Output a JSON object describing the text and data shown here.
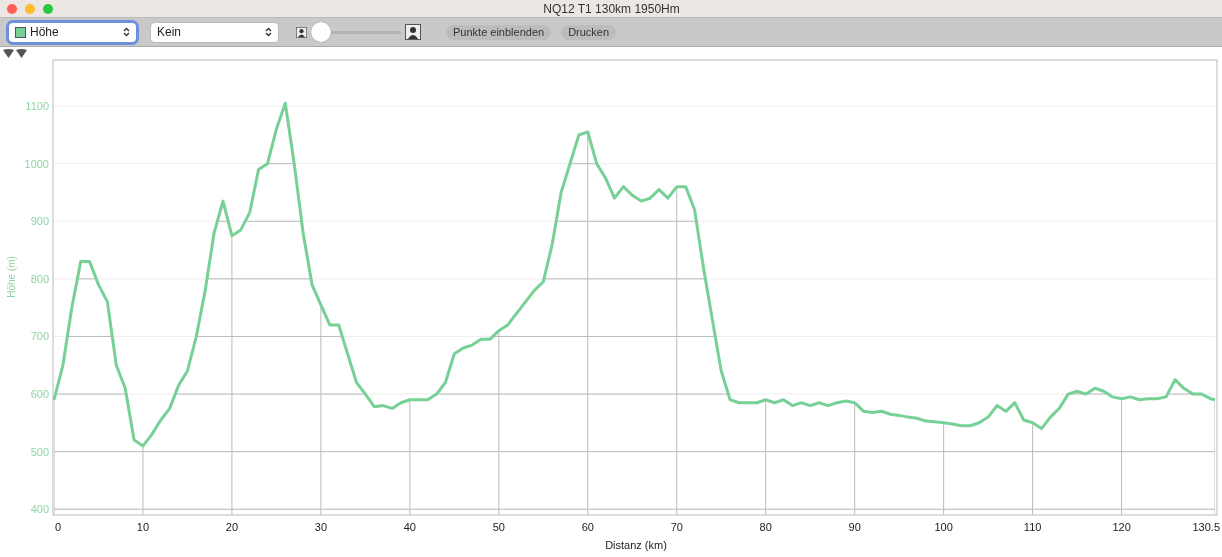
{
  "window": {
    "title": "NQ12 T1 130km 1950Hm"
  },
  "toolbar": {
    "primary_select": {
      "focused": true
    },
    "secondary_select": {
      "value": "Kein",
      "focused": false
    },
    "zoom_slider": {
      "level": 0
    },
    "buttons": [
      "Punkte einblenden",
      "Drucken"
    ]
  },
  "chart": {
    "chart_data": {
      "type": "line",
      "xlabel": "Distanz (km)",
      "ylabel": "Höhe (m)",
      "x": [
        0,
        1,
        2,
        3,
        4,
        5,
        6,
        7,
        8,
        9,
        10,
        11,
        12,
        13,
        14,
        15,
        16,
        17,
        18,
        19,
        20,
        21,
        22,
        23,
        24,
        25,
        26,
        27,
        28,
        29,
        30,
        31,
        32,
        33,
        34,
        35,
        36,
        37,
        38,
        39,
        40,
        41,
        42,
        43,
        44,
        45,
        46,
        47,
        48,
        49,
        50,
        51,
        52,
        53,
        54,
        55,
        56,
        57,
        58,
        59,
        60,
        61,
        62,
        63,
        64,
        65,
        66,
        67,
        68,
        69,
        70,
        71,
        72,
        73,
        74,
        75,
        76,
        77,
        78,
        79,
        80,
        81,
        82,
        83,
        84,
        85,
        86,
        87,
        88,
        89,
        90,
        91,
        92,
        93,
        94,
        95,
        96,
        97,
        98,
        99,
        100,
        101,
        102,
        103,
        104,
        105,
        106,
        107,
        108,
        109,
        110,
        111,
        112,
        113,
        114,
        115,
        116,
        117,
        118,
        119,
        120,
        121,
        122,
        123,
        124,
        125,
        126,
        127,
        128,
        129,
        130,
        130.5
      ],
      "series": [
        {
          "name": "Höhe",
          "color": "#77d196",
          "values": [
            590,
            650,
            750,
            830,
            830,
            790,
            760,
            650,
            610,
            520,
            510,
            530,
            555,
            575,
            615,
            640,
            700,
            780,
            880,
            935,
            875,
            885,
            915,
            990,
            1000,
            1060,
            1105,
            1000,
            880,
            790,
            755,
            720,
            720,
            670,
            620,
            600,
            578,
            580,
            575,
            585,
            590,
            590,
            590,
            600,
            620,
            670,
            680,
            685,
            695,
            695,
            710,
            720,
            740,
            760,
            780,
            795,
            860,
            950,
            1000,
            1050,
            1055,
            1000,
            975,
            940,
            960,
            945,
            935,
            940,
            955,
            940,
            960,
            960,
            920,
            820,
            730,
            640,
            590,
            585,
            585,
            585,
            590,
            585,
            590,
            580,
            585,
            580,
            585,
            580,
            585,
            588,
            585,
            570,
            568,
            570,
            565,
            563,
            560,
            558,
            553,
            552,
            550,
            548,
            545,
            545,
            550,
            560,
            580,
            570,
            585,
            555,
            550,
            540,
            560,
            575,
            600,
            605,
            600,
            610,
            605,
            595,
            592,
            595,
            590,
            592,
            592,
            595,
            625,
            610,
            600,
            600,
            592,
            590
          ]
        }
      ],
      "xlim": [
        0,
        130.5
      ],
      "ylim": [
        390,
        1180
      ],
      "grid": true,
      "xticks": [
        0,
        10,
        20,
        30,
        40,
        50,
        60,
        70,
        80,
        90,
        100,
        110,
        120,
        130.5
      ],
      "yticks": [
        400,
        500,
        600,
        700,
        800,
        900,
        1000,
        1100
      ]
    }
  }
}
